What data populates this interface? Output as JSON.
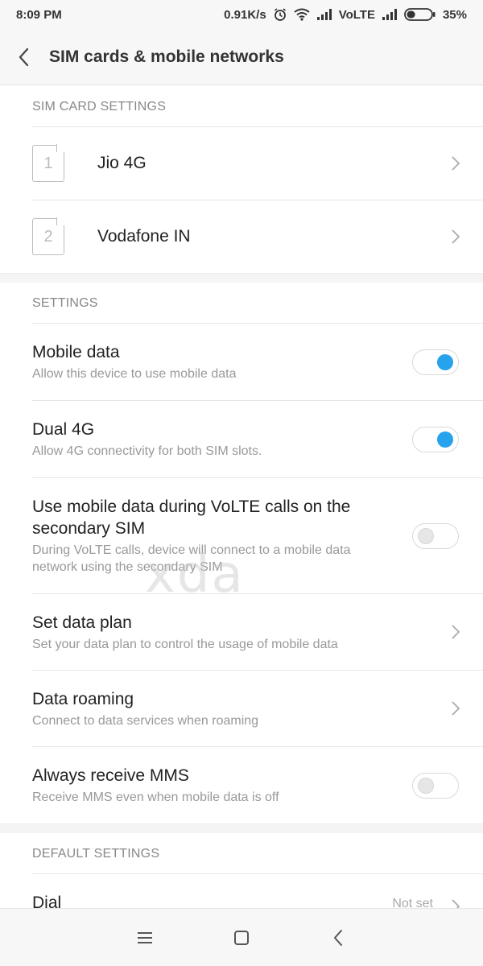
{
  "status_bar": {
    "time": "8:09 PM",
    "speed": "0.91K/s",
    "volte": "VoLTE",
    "battery": "35%",
    "battery_level": 0.35,
    "icons": [
      "alarm-icon",
      "wifi-icon",
      "signal-icon",
      "signal-icon",
      "battery-icon"
    ]
  },
  "app_bar": {
    "title": "SIM cards & mobile networks",
    "back_icon": "back-arrow-icon"
  },
  "sim_section": {
    "header": "SIM CARD SETTINGS",
    "sims": [
      {
        "slot": "1",
        "name": "Jio 4G"
      },
      {
        "slot": "2",
        "name": "Vodafone IN"
      }
    ]
  },
  "settings_section": {
    "header": "SETTINGS",
    "mobile_data": {
      "title": "Mobile data",
      "subtitle": "Allow this device to use mobile data",
      "enabled": true
    },
    "dual_4g": {
      "title": "Dual 4G",
      "subtitle": "Allow 4G connectivity for both SIM slots.",
      "enabled": true
    },
    "volte_data": {
      "title": "Use mobile data during VoLTE calls on the secondary SIM",
      "subtitle": "During VoLTE calls, device will connect to a mobile data network using the secondary SIM",
      "enabled": false
    },
    "data_plan": {
      "title": "Set data plan",
      "subtitle": "Set your data plan to control the usage of mobile data"
    },
    "data_roaming": {
      "title": "Data roaming",
      "subtitle": "Connect to data services when roaming"
    },
    "always_mms": {
      "title": "Always receive MMS",
      "subtitle": "Receive MMS even when mobile data is off",
      "enabled": false
    }
  },
  "default_section": {
    "header": "DEFAULT SETTINGS",
    "dial": {
      "title": "Dial",
      "value": "Not set"
    }
  },
  "watermark": "xda",
  "colors": {
    "accent": "#27a3ee",
    "header_text": "#888888",
    "background": "#ffffff",
    "bar_bg": "#f7f7f7"
  }
}
